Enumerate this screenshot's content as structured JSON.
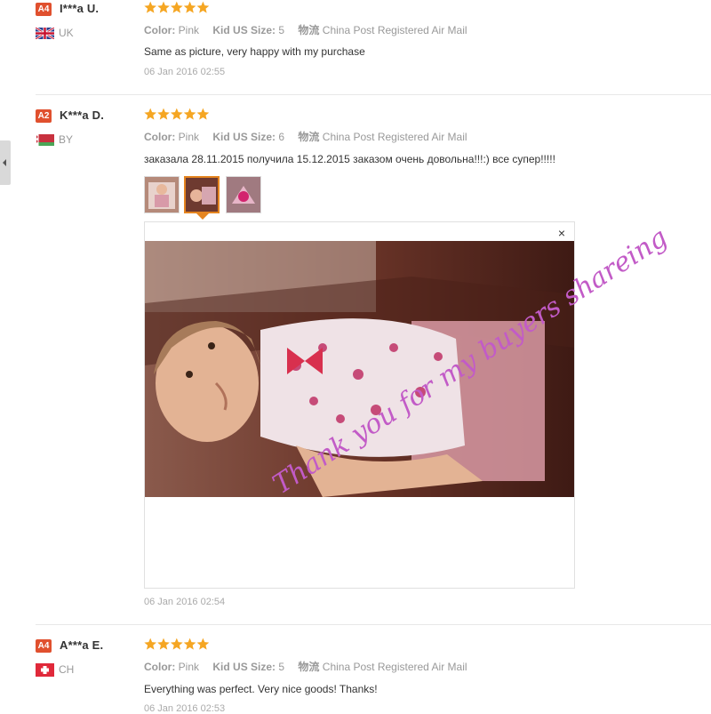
{
  "reviews": [
    {
      "level": "A4",
      "name": "I***a U.",
      "country": "UK",
      "stars": 5,
      "color_label": "Color:",
      "color_value": "Pink",
      "size_label": "Kid US Size:",
      "size_value": "5",
      "shipping_label": "物流",
      "shipping_value": "China Post Registered Air Mail",
      "text": "Same as picture, very happy with my purchase",
      "date": "06 Jan 2016 02:55"
    },
    {
      "level": "A2",
      "name": "K***a D.",
      "country": "BY",
      "stars": 5,
      "color_label": "Color:",
      "color_value": "Pink",
      "size_label": "Kid US Size:",
      "size_value": "6",
      "shipping_label": "物流",
      "shipping_value": "China Post Registered Air Mail",
      "text": "заказала 28.11.2015 получила 15.12.2015 заказом очень довольна!!!:) все супер!!!!!",
      "date": "06 Jan 2016 02:54",
      "photos": 3,
      "active_photo": 2
    },
    {
      "level": "A4",
      "name": "A***a E.",
      "country": "CH",
      "stars": 5,
      "color_label": "Color:",
      "color_value": "Pink",
      "size_label": "Kid US Size:",
      "size_value": "5",
      "shipping_label": "物流",
      "shipping_value": "China Post Registered Air Mail",
      "text": "Everything was perfect. Very nice goods! Thanks!",
      "date": "06 Jan 2016 02:53"
    }
  ],
  "viewer": {
    "close": "×"
  },
  "watermark": "Thank you for my buyers shareing",
  "colors": {
    "star": "#f5a623",
    "level_badge": "#e0502e",
    "watermark": "#c25bc7",
    "active_thumb": "#e58520"
  }
}
